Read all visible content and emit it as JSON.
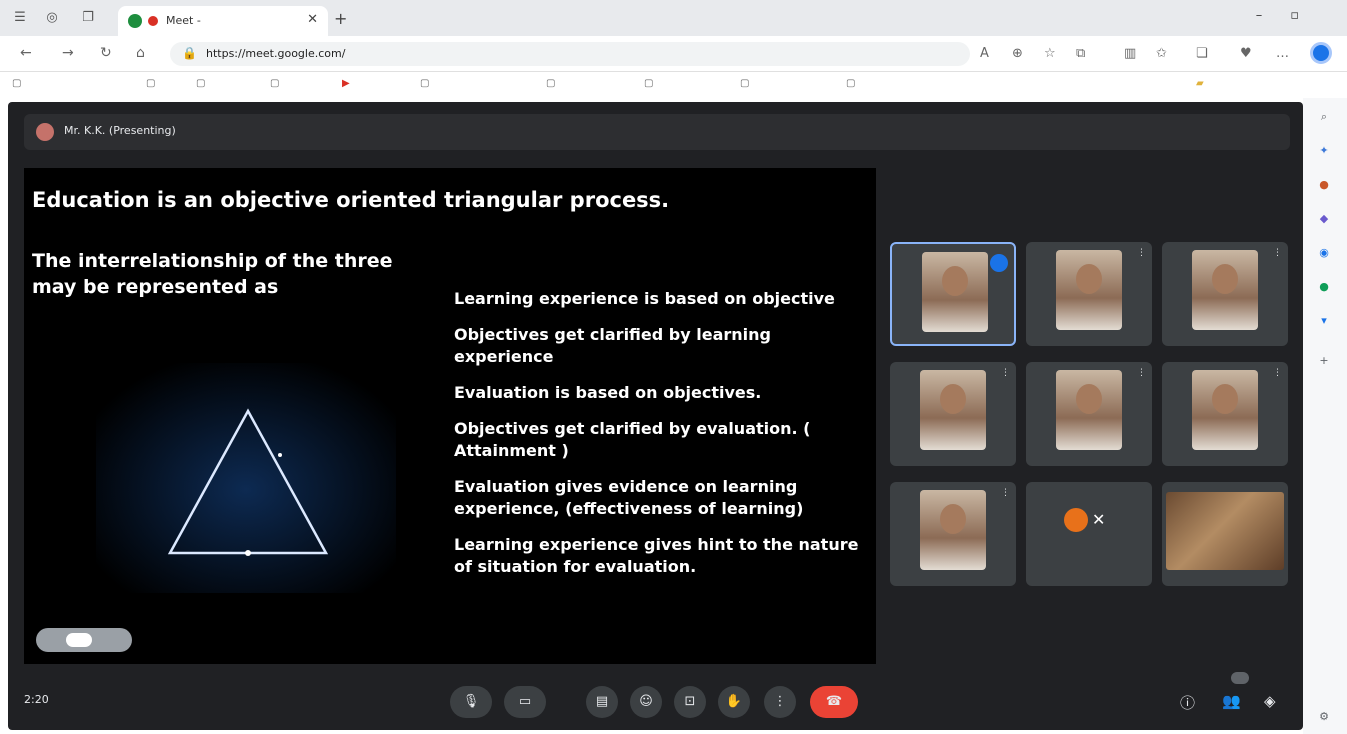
{
  "browser": {
    "tab_title": "Meet - ",
    "url": "https://meet.google.com/",
    "bookmarks": [
      "",
      "",
      "",
      "",
      "",
      "",
      "",
      "",
      "",
      "",
      ""
    ]
  },
  "meet": {
    "presenter_label": "Mr. K.K. (Presenting)",
    "clock": "2:20",
    "meeting_code": "",
    "participants_badge": ""
  },
  "slide": {
    "title": "Education is an objective oriented triangular process.",
    "subtitle_line1": "The interrelationship of the three",
    "subtitle_line2": "may be represented as",
    "points": [
      "Learning experience is based on objective",
      "Objectives get clarified by learning experience",
      "Evaluation is based on objectives.",
      "Objectives get clarified by evaluation. ( Attainment )",
      "Evaluation gives evidence on learning experience, (effectiveness of learning)",
      "Learning experience gives hint to the nature of situation for evaluation."
    ],
    "triangle_labels": {
      "top": "",
      "left": "",
      "right": ""
    }
  },
  "participants": [
    {
      "name": "",
      "kind": "photo",
      "active": true
    },
    {
      "name": "",
      "kind": "photo",
      "active": false
    },
    {
      "name": "",
      "kind": "photo",
      "active": false
    },
    {
      "name": "",
      "kind": "photo",
      "active": false
    },
    {
      "name": "",
      "kind": "photo",
      "active": false
    },
    {
      "name": "",
      "kind": "photo",
      "active": false
    },
    {
      "name": "",
      "kind": "photo",
      "active": false
    },
    {
      "name": "",
      "kind": "avatar",
      "active": false
    },
    {
      "name": "",
      "kind": "room",
      "active": false
    }
  ],
  "icons": {
    "mic": "mic-icon",
    "camera": "camera-icon",
    "captions": "captions-icon",
    "emoji": "emoji-icon",
    "present": "present-icon",
    "raise_hand": "raise-hand-icon",
    "more": "more-options-icon",
    "end_call": "end-call-icon",
    "info": "info-icon",
    "people": "people-icon",
    "activities": "activities-icon"
  },
  "colors": {
    "meet_bg": "#202124",
    "end_call": "#ea4335",
    "active_speaker": "#1a73e8"
  }
}
